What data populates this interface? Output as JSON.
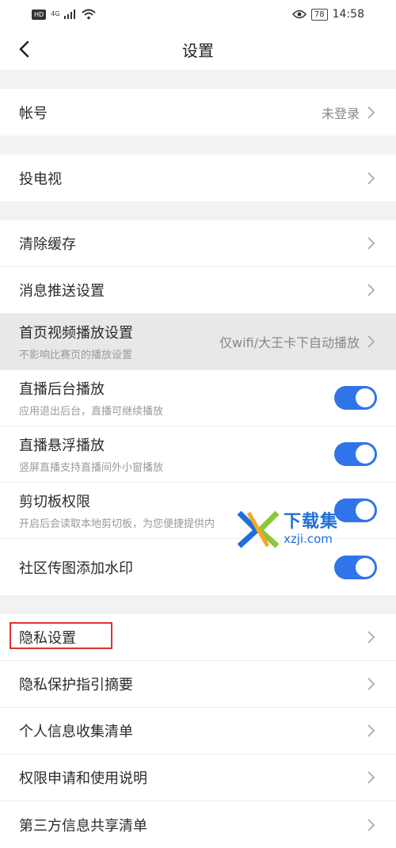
{
  "status_bar": {
    "hd": "HD",
    "network": "4G",
    "battery": "78",
    "time": "14:58"
  },
  "nav": {
    "title": "设置"
  },
  "account": {
    "label": "帐号",
    "value": "未登录"
  },
  "cast": {
    "label": "投电视"
  },
  "settings": {
    "clear_cache": "清除缓存",
    "push": "消息推送设置",
    "home_video": {
      "title": "首页视频播放设置",
      "subtitle": "不影响比赛页的播放设置",
      "value": "仅wifi/大王卡下自动播放"
    },
    "bg_play": {
      "title": "直播后台播放",
      "subtitle": "应用退出后台，直播可继续播放",
      "on": true
    },
    "float_play": {
      "title": "直播悬浮播放",
      "subtitle": "竖屏直播支持直播间外小窗播放",
      "on": true
    },
    "clipboard": {
      "title": "剪切板权限",
      "subtitle": "开启后会读取本地剪切板，为您便捷提供内",
      "on": true
    },
    "watermark_toggle": {
      "title": "社区传图添加水印",
      "on": true
    }
  },
  "privacy": {
    "privacy_settings": "隐私设置",
    "guide": "隐私保护指引摘要",
    "collect": "个人信息收集清单",
    "permissions": "权限申请和使用说明",
    "third_party": "第三方信息共享清单"
  },
  "watermark": {
    "cn": "下载集",
    "en": "xzji.com"
  },
  "colors": {
    "accent": "#2f74e8",
    "highlight_box": "#dd3333",
    "watermark": "#1f6fd8"
  }
}
